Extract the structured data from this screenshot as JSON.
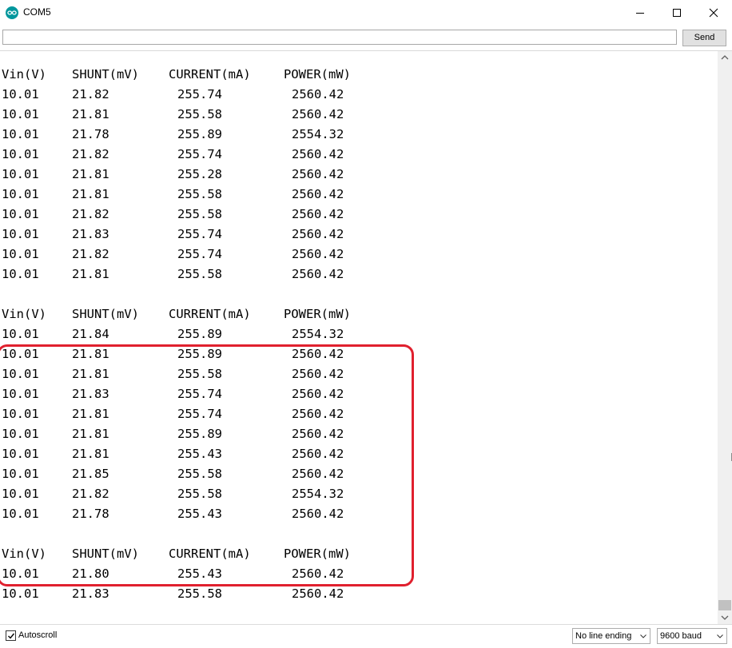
{
  "window": {
    "title": "COM5"
  },
  "send": {
    "input_value": "",
    "button_label": "Send"
  },
  "console": {
    "lines": [
      [
        "Vin(V)",
        "SHUNT(mV)",
        "CURRENT(mA)",
        "POWER(mW)"
      ],
      [
        "10.01",
        "21.82",
        "255.74",
        "2560.42"
      ],
      [
        "10.01",
        "21.81",
        "255.58",
        "2560.42"
      ],
      [
        "10.01",
        "21.78",
        "255.89",
        "2554.32"
      ],
      [
        "10.01",
        "21.82",
        "255.74",
        "2560.42"
      ],
      [
        "10.01",
        "21.81",
        "255.28",
        "2560.42"
      ],
      [
        "10.01",
        "21.81",
        "255.58",
        "2560.42"
      ],
      [
        "10.01",
        "21.82",
        "255.58",
        "2560.42"
      ],
      [
        "10.01",
        "21.83",
        "255.74",
        "2560.42"
      ],
      [
        "10.01",
        "21.82",
        "255.74",
        "2560.42"
      ],
      [
        "10.01",
        "21.81",
        "255.58",
        "2560.42"
      ],
      [
        "",
        "",
        "",
        ""
      ],
      [
        "Vin(V)",
        "SHUNT(mV)",
        "CURRENT(mA)",
        "POWER(mW)"
      ],
      [
        "10.01",
        "21.84",
        "255.89",
        "2554.32"
      ],
      [
        "10.01",
        "21.81",
        "255.89",
        "2560.42"
      ],
      [
        "10.01",
        "21.81",
        "255.58",
        "2560.42"
      ],
      [
        "10.01",
        "21.83",
        "255.74",
        "2560.42"
      ],
      [
        "10.01",
        "21.81",
        "255.74",
        "2560.42"
      ],
      [
        "10.01",
        "21.81",
        "255.89",
        "2560.42"
      ],
      [
        "10.01",
        "21.81",
        "255.43",
        "2560.42"
      ],
      [
        "10.01",
        "21.85",
        "255.58",
        "2560.42"
      ],
      [
        "10.01",
        "21.82",
        "255.58",
        "2554.32"
      ],
      [
        "10.01",
        "21.78",
        "255.43",
        "2560.42"
      ],
      [
        "",
        "",
        "",
        ""
      ],
      [
        "Vin(V)",
        "SHUNT(mV)",
        "CURRENT(mA)",
        "POWER(mW)"
      ],
      [
        "10.01",
        "21.80",
        "255.43",
        "2560.42"
      ],
      [
        "10.01",
        "21.83",
        "255.58",
        "2560.42"
      ]
    ]
  },
  "status": {
    "autoscroll_label": "Autoscroll",
    "autoscroll_checked": true,
    "line_ending": "No line ending",
    "baud_rate": "9600 baud"
  },
  "colors": {
    "highlight": "#e0202e",
    "arduino_teal": "#00979d"
  },
  "icons": [
    "arduino-logo-icon",
    "minimize-icon",
    "maximize-icon",
    "close-icon",
    "check-icon",
    "chevron-down-icon",
    "scroll-up-arrow-icon",
    "scroll-down-arrow-icon"
  ]
}
